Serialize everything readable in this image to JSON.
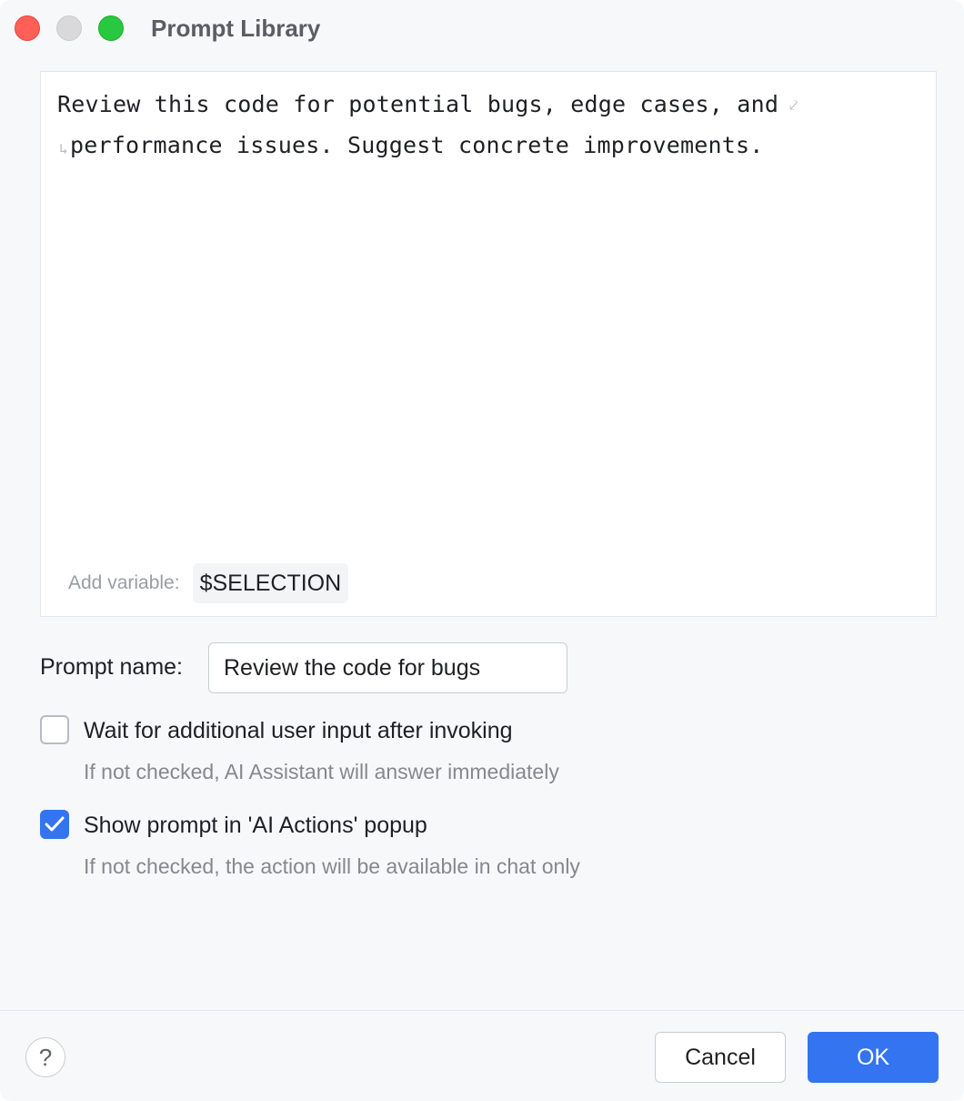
{
  "window": {
    "title": "Prompt Library"
  },
  "editor": {
    "lines": [
      "Review this code for potential bugs, edge cases, and",
      "performance issues. Suggest concrete improvements."
    ],
    "wrap_icon": "soft-wrap-icon",
    "add_variable_label": "Add variable:",
    "variable_chip": "$SELECTION"
  },
  "form": {
    "prompt_name_label": "Prompt name:",
    "prompt_name_value": "Review the code for bugs",
    "options": [
      {
        "label": "Wait for additional user input after invoking",
        "hint": "If not checked, AI Assistant will answer immediately",
        "checked": false
      },
      {
        "label": "Show prompt in 'AI Actions' popup",
        "hint": "If not checked, the action will be available in chat only",
        "checked": true
      }
    ]
  },
  "footer": {
    "help_glyph": "?",
    "cancel_label": "Cancel",
    "ok_label": "OK"
  },
  "colors": {
    "accent": "#3574f0",
    "window_bg": "#f7f8fa",
    "close": "#ff5f57",
    "maximize": "#28c840"
  }
}
